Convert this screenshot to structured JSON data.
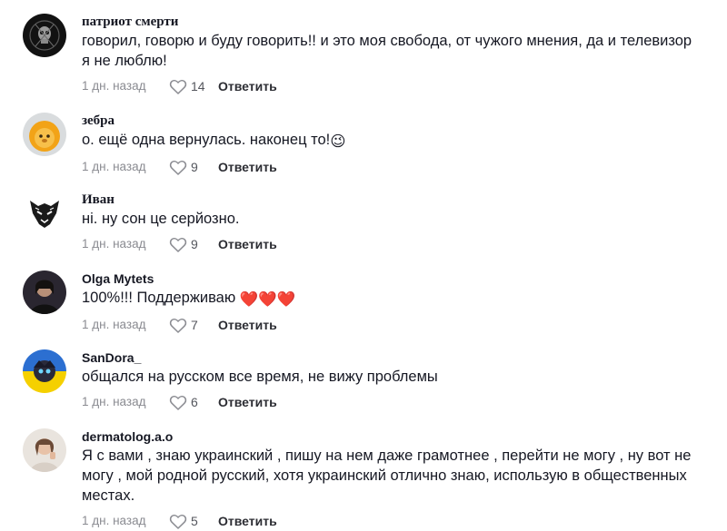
{
  "comments": [
    {
      "username": "патриот смерти",
      "text": "говорил, говорю и буду говорить!! и это моя свобода, от чужого мнения, да и телевизор я не люблю!",
      "time": "1 дн. назад",
      "likes": "14",
      "reply_label": "Ответить",
      "avatar": "dark-skull-avatar"
    },
    {
      "username": "зебра",
      "text": "о. ещё одна вернулась. наконец то!",
      "emoji": "😉",
      "time": "1 дн. назад",
      "likes": "9",
      "reply_label": "Ответить",
      "avatar": "orange-plush-avatar"
    },
    {
      "username": "Иван",
      "text": "ні. ну сон це серйозно.",
      "time": "1 дн. назад",
      "likes": "9",
      "reply_label": "Ответить",
      "avatar": "wolf-tribal-avatar"
    },
    {
      "username": "Olga Mytets",
      "text": "100%!!! Поддерживаю",
      "emoji": "❤️❤️❤️",
      "time": "1 дн. назад",
      "likes": "7",
      "reply_label": "Ответить",
      "avatar": "dark-portrait-avatar"
    },
    {
      "username": "SanDora_",
      "text": "общался на русском все время, не вижу проблемы",
      "time": "1 дн. назад",
      "likes": "6",
      "reply_label": "Ответить",
      "avatar": "blue-yellow-anime-avatar"
    },
    {
      "username": "dermatolog.a.o",
      "text": "Я с вами , знаю украинский , пишу на нем даже грамотнее , перейти не могу , ну вот не могу , мой родной русский, хотя украинский отлично знаю, использую в общественных местах.",
      "time": "1 дн. назад",
      "likes": "5",
      "reply_label": "Ответить",
      "avatar": "woman-portrait-avatar"
    }
  ],
  "colors": {
    "text": "#161823",
    "meta": "#8a8b91",
    "reply": "#2c2d33"
  },
  "icons": {
    "like": "heart-outline-icon"
  }
}
